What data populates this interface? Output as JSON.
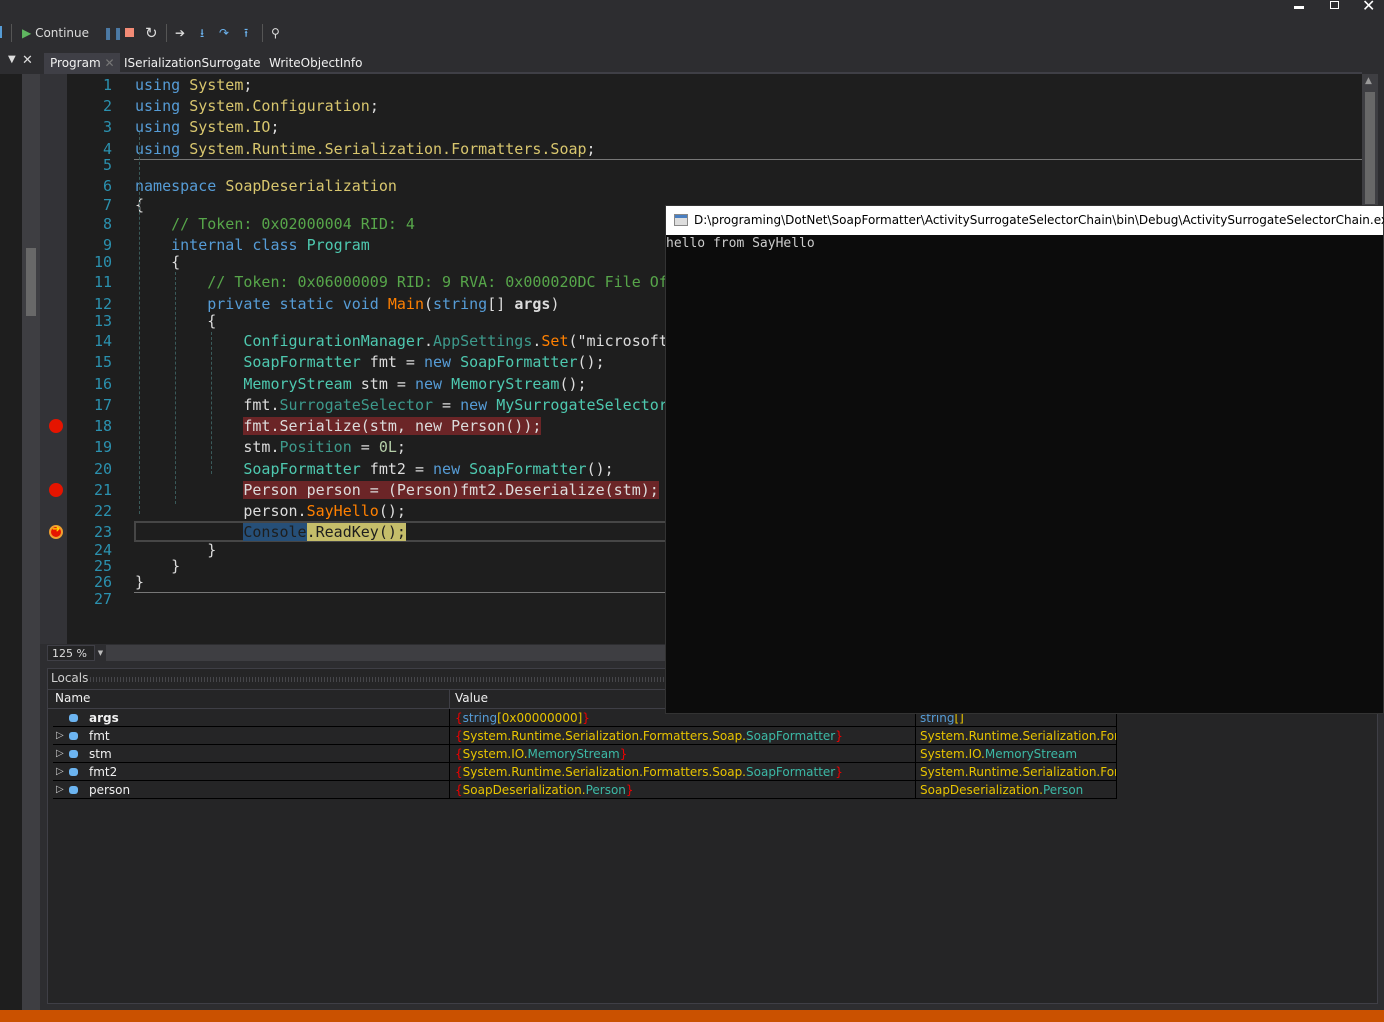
{
  "window_controls": {
    "minimize": "minimize-icon",
    "restore": "restore-icon",
    "close": "close-icon"
  },
  "toolbar": {
    "continue_label": "Continue",
    "icons": [
      "play-icon",
      "pause-icon",
      "stop-icon",
      "restart-icon",
      "show-next-statement-icon",
      "step-into-icon",
      "step-over-icon",
      "step-out-icon",
      "search-icon"
    ]
  },
  "tabs": [
    {
      "label": "Program",
      "active": true
    },
    {
      "label": "ISerializationSurrogate"
    },
    {
      "label": "WriteObjectInfo"
    }
  ],
  "editor": {
    "breakpoint_lines": [
      18,
      21
    ],
    "current_line": 23,
    "lines": [
      [
        [
          "kw",
          "using "
        ],
        [
          "ns",
          "System"
        ],
        [
          "pl",
          ";"
        ]
      ],
      [
        [
          "kw",
          "using "
        ],
        [
          "ns",
          "System.Configuration"
        ],
        [
          "pl",
          ";"
        ]
      ],
      [
        [
          "kw",
          "using "
        ],
        [
          "ns",
          "System.IO"
        ],
        [
          "pl",
          ";"
        ]
      ],
      [
        [
          "kw",
          "using "
        ],
        [
          "ns",
          "System.Runtime.Serialization.Formatters.Soap"
        ],
        [
          "pl",
          ";"
        ]
      ],
      [],
      [
        [
          "kw",
          "namespace "
        ],
        [
          "ns",
          "SoapDeserialization"
        ]
      ],
      [
        [
          "pl",
          "{"
        ]
      ],
      [
        [
          "pl",
          "    "
        ],
        [
          "cm",
          "// Token: 0x02000004 RID: 4"
        ]
      ],
      [
        [
          "pl",
          "    "
        ],
        [
          "kw",
          "internal class "
        ],
        [
          "ty",
          "Program"
        ]
      ],
      [
        [
          "pl",
          "    {"
        ]
      ],
      [
        [
          "pl",
          "        "
        ],
        [
          "cm",
          "// Token: 0x06000009 RID: 9 RVA: 0x000020DC File Of"
        ]
      ],
      [
        [
          "pl",
          "        "
        ],
        [
          "kw",
          "private static void "
        ],
        [
          "mt",
          "Main"
        ],
        [
          "pl",
          "("
        ],
        [
          "kw",
          "string"
        ],
        [
          "pl",
          "[] "
        ],
        [
          "bold",
          "args"
        ],
        [
          "pl",
          ")"
        ]
      ],
      [
        [
          "pl",
          "        {"
        ]
      ],
      [
        [
          "pl",
          "            "
        ],
        [
          "ty",
          "ConfigurationManager"
        ],
        [
          "pl",
          "."
        ],
        [
          "pr",
          "AppSettings"
        ],
        [
          "pl",
          "."
        ],
        [
          "mt",
          "Set"
        ],
        [
          "pl",
          "(\"microsoft"
        ]
      ],
      [
        [
          "pl",
          "            "
        ],
        [
          "ty",
          "SoapFormatter"
        ],
        [
          "pl",
          " fmt = "
        ],
        [
          "kw",
          "new "
        ],
        [
          "ty",
          "SoapFormatter"
        ],
        [
          "pl",
          "();"
        ]
      ],
      [
        [
          "pl",
          "            "
        ],
        [
          "ty",
          "MemoryStream"
        ],
        [
          "pl",
          " stm = "
        ],
        [
          "kw",
          "new "
        ],
        [
          "ty",
          "MemoryStream"
        ],
        [
          "pl",
          "();"
        ]
      ],
      [
        [
          "pl",
          "            fmt."
        ],
        [
          "pr",
          "SurrogateSelector"
        ],
        [
          "pl",
          " = "
        ],
        [
          "kw",
          "new "
        ],
        [
          "ty",
          "MySurrogateSelector"
        ]
      ],
      [
        [
          "pl",
          "            "
        ],
        [
          "bp-hl",
          "fmt.Serialize(stm, new Person());"
        ]
      ],
      [
        [
          "pl",
          "            stm."
        ],
        [
          "pr",
          "Position"
        ],
        [
          "pl",
          " = "
        ],
        [
          "num",
          "0L"
        ],
        [
          "pl",
          ";"
        ]
      ],
      [
        [
          "pl",
          "            "
        ],
        [
          "ty",
          "SoapFormatter"
        ],
        [
          "pl",
          " fmt2 = "
        ],
        [
          "kw",
          "new "
        ],
        [
          "ty",
          "SoapFormatter"
        ],
        [
          "pl",
          "();"
        ]
      ],
      [
        [
          "pl",
          "            "
        ],
        [
          "bp-hl",
          "Person person = (Person)fmt2.Deserialize(stm);"
        ]
      ],
      [
        [
          "pl",
          "            person."
        ],
        [
          "mt",
          "SayHello"
        ],
        [
          "pl",
          "();"
        ]
      ],
      [
        [
          "pl",
          "            "
        ],
        [
          "cur-sel",
          "Console"
        ],
        [
          "cur-hl",
          ".ReadKey();"
        ]
      ],
      [
        [
          "pl",
          "        }"
        ]
      ],
      [
        [
          "pl",
          "    }"
        ]
      ],
      [
        [
          "pl",
          "}"
        ]
      ],
      []
    ]
  },
  "zoom_level": "125 %",
  "console": {
    "title": "D:\\programing\\DotNet\\SoapFormatter\\ActivitySurrogateSelectorChain\\bin\\Debug\\ActivitySurrogateSelectorChain.exe",
    "output": "hello from SayHello"
  },
  "locals": {
    "title": "Locals",
    "columns": {
      "name": "Name",
      "value": "Value"
    },
    "rows": [
      {
        "name": "args",
        "expandable": false,
        "value": [
          [
            "r",
            "{"
          ],
          [
            "b",
            "string"
          ],
          [
            "y",
            "[0x00000000]"
          ],
          [
            "r",
            "}"
          ]
        ],
        "type": [
          [
            "b",
            "string"
          ],
          [
            "y",
            "[]"
          ]
        ]
      },
      {
        "name": "fmt",
        "expandable": true,
        "value": [
          [
            "r",
            "{"
          ],
          [
            "y",
            "System.Runtime.Serialization.Formatters.Soap."
          ],
          [
            "t",
            "SoapFormatter"
          ],
          [
            "r",
            "}"
          ]
        ],
        "type": [
          [
            "y",
            "System.Runtime.Serialization.For..."
          ]
        ]
      },
      {
        "name": "stm",
        "expandable": true,
        "value": [
          [
            "r",
            "{"
          ],
          [
            "y",
            "System.IO."
          ],
          [
            "t",
            "MemoryStream"
          ],
          [
            "r",
            "}"
          ]
        ],
        "type": [
          [
            "y",
            "System.IO."
          ],
          [
            "t",
            "MemoryStream"
          ]
        ]
      },
      {
        "name": "fmt2",
        "expandable": true,
        "value": [
          [
            "r",
            "{"
          ],
          [
            "y",
            "System.Runtime.Serialization.Formatters.Soap."
          ],
          [
            "t",
            "SoapFormatter"
          ],
          [
            "r",
            "}"
          ]
        ],
        "type": [
          [
            "y",
            "System.Runtime.Serialization.For..."
          ]
        ]
      },
      {
        "name": "person",
        "expandable": true,
        "value": [
          [
            "r",
            "{"
          ],
          [
            "y",
            "SoapDeserialization."
          ],
          [
            "t",
            "Person"
          ],
          [
            "r",
            "}"
          ]
        ],
        "type": [
          [
            "y",
            "SoapDeserialization."
          ],
          [
            "t",
            "Person"
          ]
        ]
      }
    ]
  },
  "colors": {
    "status_bar": "#ca5100",
    "breakpoint": "#e51400",
    "line_number": "#2b91af"
  }
}
